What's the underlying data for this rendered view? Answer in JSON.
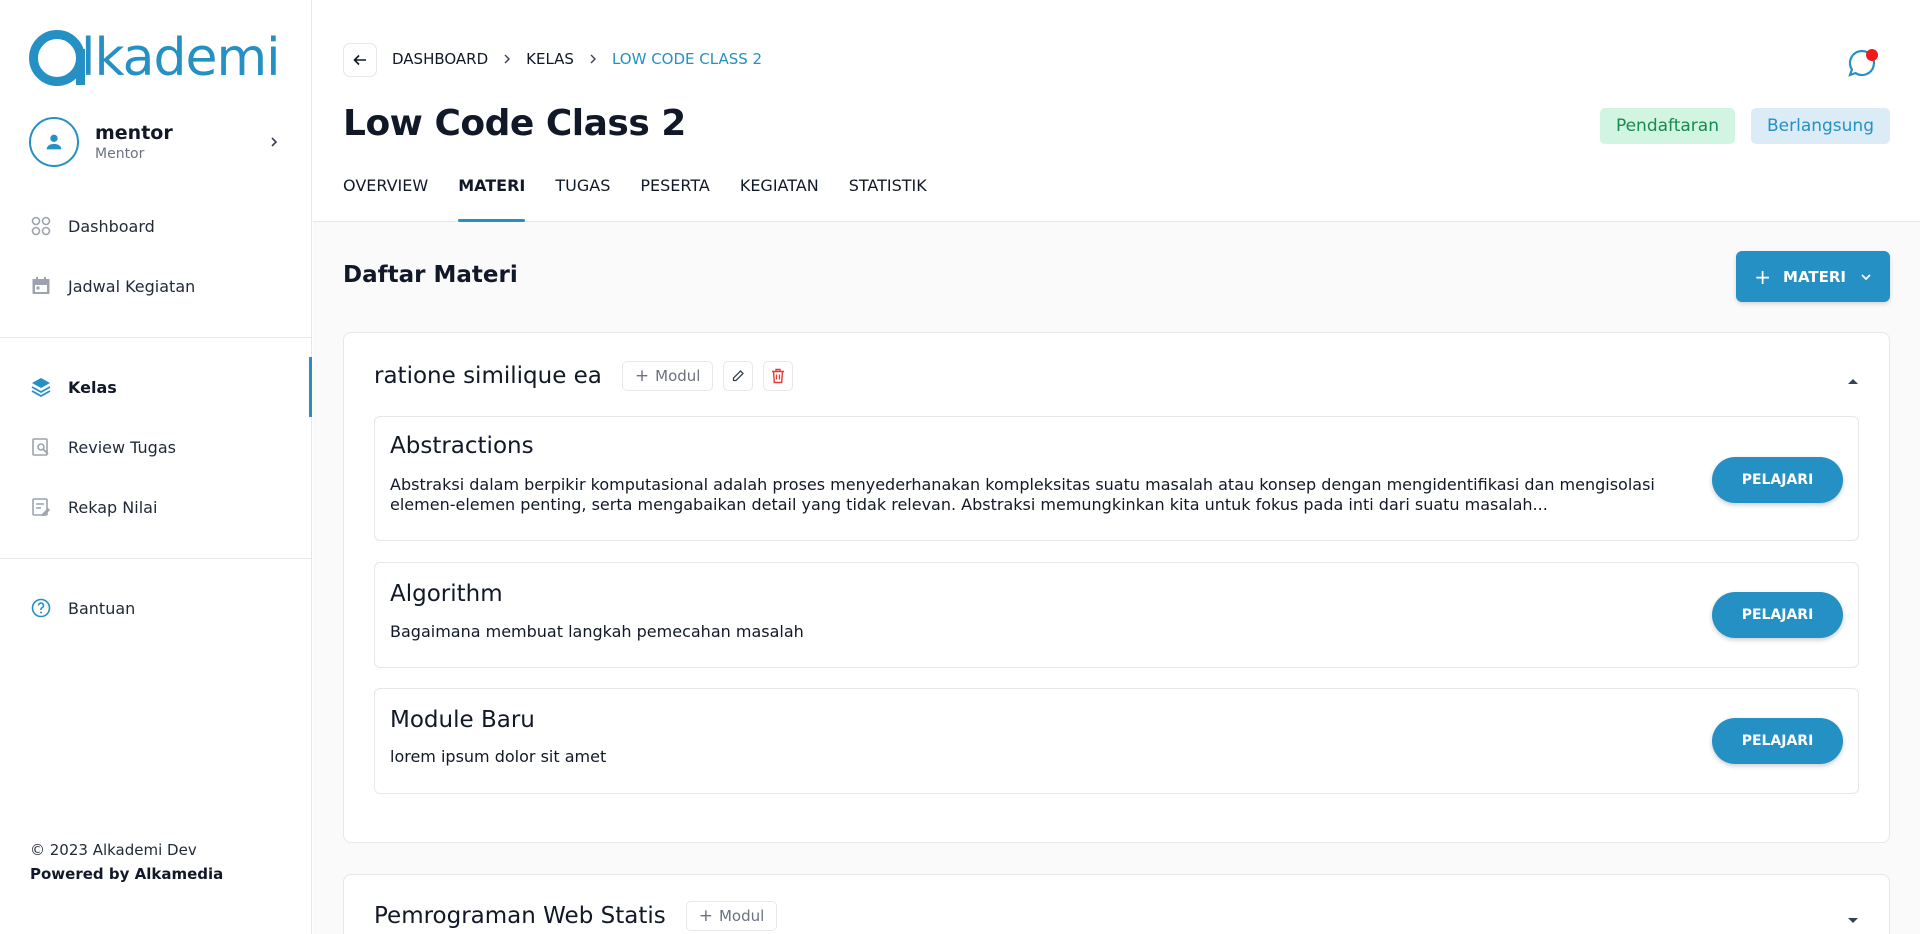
{
  "brand": {
    "logo_text": "lkademi",
    "color": "#2590c4"
  },
  "user": {
    "name": "mentor",
    "role": "Mentor"
  },
  "sidebar": {
    "items": [
      {
        "label": "Dashboard",
        "icon": "grid-icon"
      },
      {
        "label": "Jadwal Kegiatan",
        "icon": "calendar-icon"
      },
      {
        "label": "Kelas",
        "icon": "layers-icon",
        "active": true
      },
      {
        "label": "Review Tugas",
        "icon": "review-icon"
      },
      {
        "label": "Rekap Nilai",
        "icon": "edit-note-icon"
      },
      {
        "label": "Bantuan",
        "icon": "help-icon"
      }
    ],
    "copyright": "© 2023 Alkademi Dev",
    "powered": "Powered by Alkamedia"
  },
  "breadcrumb": [
    "DASHBOARD",
    "KELAS",
    "LOW CODE CLASS 2"
  ],
  "page": {
    "title": "Low Code Class 2",
    "badges": [
      "Pendaftaran",
      "Berlangsung"
    ]
  },
  "tabs": [
    "OVERVIEW",
    "MATERI",
    "TUGAS",
    "PESERTA",
    "KEGIATAN",
    "STATISTIK"
  ],
  "materi": {
    "section_title": "Daftar Materi",
    "add_button": "MATERI",
    "modul_button": "Modul",
    "learn_button": "PELAJARI",
    "groups": [
      {
        "title": "ratione similique ea",
        "modules": [
          {
            "title": "Abstractions",
            "desc": "Abstraksi dalam berpikir komputasional adalah proses menyederhanakan kompleksitas suatu masalah atau konsep dengan mengidentifikasi dan mengisolasi elemen-elemen penting, serta mengabaikan detail yang tidak relevan. Abstraksi memungkinkan kita untuk fokus pada inti dari suatu masalah..."
          },
          {
            "title": "Algorithm",
            "desc": "Bagaimana membuat langkah pemecahan masalah"
          },
          {
            "title": "Module Baru",
            "desc": "lorem ipsum dolor sit amet"
          }
        ]
      },
      {
        "title": "Pemrograman Web Statis",
        "modules": []
      }
    ]
  }
}
